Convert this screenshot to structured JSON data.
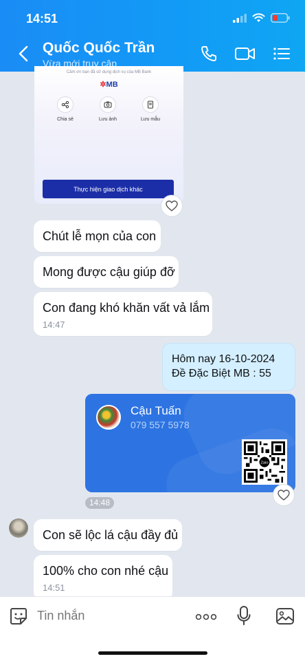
{
  "status_bar": {
    "time": "14:51"
  },
  "header": {
    "name": "Quốc Quốc Trần",
    "status": "Vừa mới truy cập"
  },
  "receipt": {
    "thanks": "Cảm ơn bạn đã sử dụng dịch vụ của MB Bank",
    "logo": "MB",
    "actions": [
      {
        "label": "Chia sẻ",
        "icon": "share-icon"
      },
      {
        "label": "Lưu ảnh",
        "icon": "camera-icon"
      },
      {
        "label": "Lưu mẫu",
        "icon": "template-icon"
      }
    ],
    "button": "Thực hiện giao dịch khác"
  },
  "messages": [
    {
      "text": "Chút lễ mọn của con"
    },
    {
      "text": "Mong được cậu giúp đỡ"
    },
    {
      "text": "Con đang khó khăn vất vả lắm",
      "time": "14:47"
    }
  ],
  "outgoing": {
    "line1": "Hôm nay 16-10-2024",
    "line2": "Đề Đặc Biệt MB : 55"
  },
  "contact_card": {
    "name": "Cậu Tuấn",
    "phone": "079 557 5978",
    "qr_label": "Zalo",
    "time": "14:48"
  },
  "messages2": [
    {
      "text": "Con sẽ lộc lá cậu đầy đủ"
    },
    {
      "text": "100% cho con nhé cậu",
      "time": "14:51"
    }
  ],
  "composer": {
    "placeholder": "Tin nhắn"
  },
  "colors": {
    "header": "#1a8cf5",
    "card": "#2d74e2",
    "outgoing_bubble": "#d4efff",
    "mb_button": "#1b2ea8"
  }
}
